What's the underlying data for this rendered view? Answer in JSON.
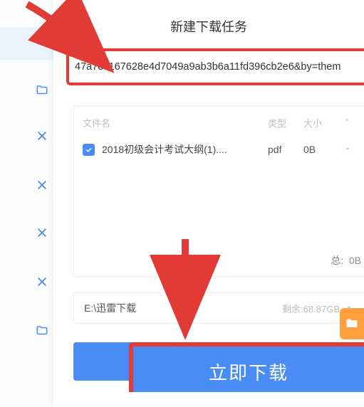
{
  "dialog": {
    "title": "新建下载任务",
    "url": "47a7ec167628e4d7049a9ab3b6a11fd396cb2e6&by=them"
  },
  "columns": {
    "name": "文件名",
    "type": "类型",
    "size": "大小"
  },
  "file": {
    "name": "2018初级会计考试大纲(1)....",
    "type": "pdf",
    "size": "0B"
  },
  "footer": {
    "total_label": "总:",
    "total_size": "0B"
  },
  "path": {
    "value": "E:\\迅雷下载",
    "free": "剩余:68.87GB"
  },
  "download": {
    "label": "立即下载"
  }
}
